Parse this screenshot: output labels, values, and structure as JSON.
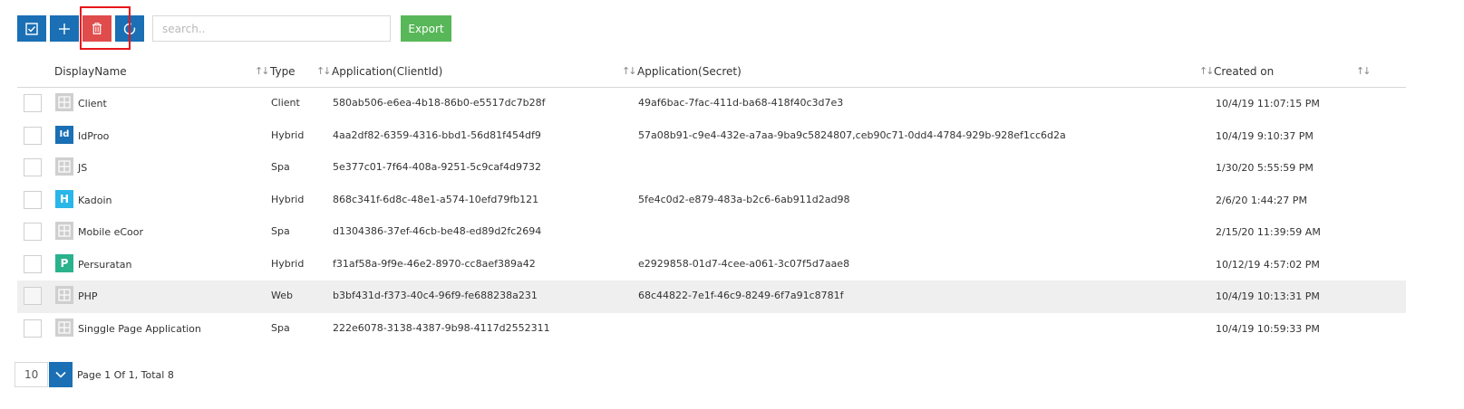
{
  "toolbar": {
    "search_placeholder": "search..",
    "export_label": "Export",
    "colors": {
      "primary": "#1a6fb5",
      "danger": "#e04b4b",
      "success": "#58b758",
      "highlight": "#e8161b"
    }
  },
  "table": {
    "columns": [
      "DisplayName",
      "Type",
      "Application(ClientId)",
      "Application(Secret)",
      "Created on"
    ],
    "rows": [
      {
        "icon": "placeholder-icon",
        "icon_letter": "",
        "icon_color": "#cfcfcf",
        "name": "Client",
        "type": "Client",
        "client_id": "580ab506-e6ea-4b18-86b0-e5517dc7b28f",
        "secret": "49af6bac-7fac-411d-ba68-418f40c3d7e3",
        "created": "10/4/19 11:07:15 PM"
      },
      {
        "icon": "letter-icon",
        "icon_letter": "Id",
        "icon_color": "#1a6fb5",
        "name": "IdProo",
        "type": "Hybrid",
        "client_id": "4aa2df82-6359-4316-bbd1-56d81f454df9",
        "secret": "57a08b91-c9e4-432e-a7aa-9ba9c5824807,ceb90c71-0dd4-4784-929b-928ef1cc6d2a",
        "created": "10/4/19 9:10:37 PM"
      },
      {
        "icon": "placeholder-icon",
        "icon_letter": "",
        "icon_color": "#cfcfcf",
        "name": "JS",
        "type": "Spa",
        "client_id": "5e377c01-7f64-408a-9251-5c9caf4d9732",
        "secret": "",
        "created": "1/30/20 5:55:59 PM"
      },
      {
        "icon": "letter-icon",
        "icon_letter": "H",
        "icon_color": "#29b6e8",
        "name": "Kadoin",
        "type": "Hybrid",
        "client_id": "868c341f-6d8c-48e1-a574-10efd79fb121",
        "secret": "5fe4c0d2-e879-483a-b2c6-6ab911d2ad98",
        "created": "2/6/20 1:44:27 PM"
      },
      {
        "icon": "placeholder-icon",
        "icon_letter": "",
        "icon_color": "#cfcfcf",
        "name": "Mobile eCoor",
        "type": "Spa",
        "client_id": "d1304386-37ef-46cb-be48-ed89d2fc2694",
        "secret": "",
        "created": "2/15/20 11:39:59 AM"
      },
      {
        "icon": "letter-icon",
        "icon_letter": "P",
        "icon_color": "#2ab28d",
        "name": "Persuratan",
        "type": "Hybrid",
        "client_id": "f31af58a-9f9e-46e2-8970-cc8aef389a42",
        "secret": "e2929858-01d7-4cee-a061-3c07f5d7aae8",
        "created": "10/12/19 4:57:02 PM"
      },
      {
        "icon": "placeholder-icon",
        "icon_letter": "",
        "icon_color": "#cfcfcf",
        "name": "PHP",
        "type": "Web",
        "client_id": "b3bf431d-f373-40c4-96f9-fe688238a231",
        "secret": "68c44822-7e1f-46c9-8249-6f7a91c8781f",
        "created": "10/4/19 10:13:31 PM"
      },
      {
        "icon": "placeholder-icon",
        "icon_letter": "",
        "icon_color": "#cfcfcf",
        "name": "Singgle Page Application",
        "type": "Spa",
        "client_id": "222e6078-3138-4387-9b98-4117d2552311",
        "secret": "",
        "created": "10/4/19 10:59:33 PM"
      }
    ],
    "highlighted_row": 6
  },
  "pager": {
    "page_size": "10",
    "summary": "Page 1 Of 1, Total 8"
  }
}
